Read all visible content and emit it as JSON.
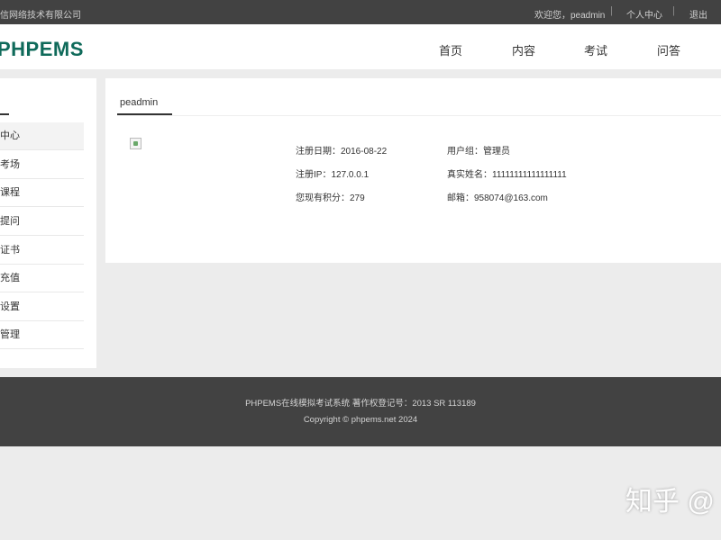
{
  "topbar": {
    "company": "信网络技术有限公司",
    "welcome": "欢迎您，peadmin",
    "separator": "|",
    "user_center": "个人中心",
    "logout": "退出"
  },
  "header": {
    "logo": "PHPEMS",
    "nav": [
      "首页",
      "内容",
      "考试",
      "问答"
    ]
  },
  "sidebar": {
    "items": [
      "中心",
      "考场",
      "课程",
      "提问",
      "证书",
      "充值",
      "设置",
      "管理"
    ],
    "active_index": 0
  },
  "main": {
    "tab_label": "peadmin",
    "info": {
      "reg_date": "注册日期：2016-08-22",
      "user_group": "用户组：管理员",
      "reg_ip": "注册IP：127.0.0.1",
      "real_name": "真实姓名：11111111111111111",
      "points": "您现有积分：279",
      "email": "邮箱：958074@163.com"
    }
  },
  "footer": {
    "line1": "PHPEMS在线模拟考试系统 著作权登记号：2013 SR 113189",
    "line2": "Copyright © phpems.net 2024"
  },
  "watermark": "知乎 @"
}
